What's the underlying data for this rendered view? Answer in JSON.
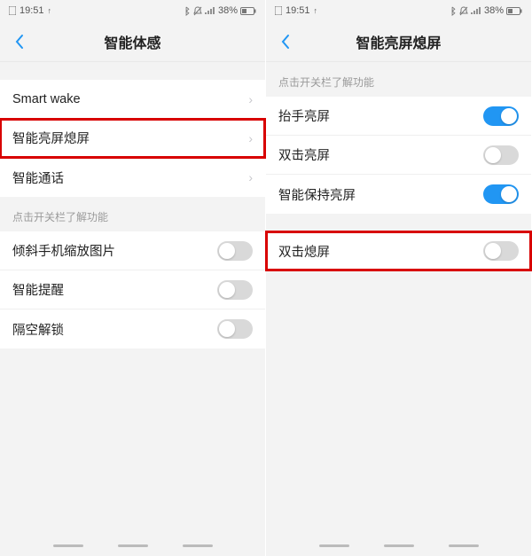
{
  "status": {
    "time": "19:51",
    "battery_pct": "38%",
    "up_arrow": "↑"
  },
  "left": {
    "title": "智能体感",
    "rows_nav": [
      {
        "label": "Smart wake"
      },
      {
        "label": "智能亮屏熄屏"
      },
      {
        "label": "智能通话"
      }
    ],
    "section_label": "点击开关栏了解功能",
    "rows_toggle": [
      {
        "label": "倾斜手机缩放图片",
        "on": false
      },
      {
        "label": "智能提醒",
        "on": false
      },
      {
        "label": "隔空解锁",
        "on": false
      }
    ]
  },
  "right": {
    "title": "智能亮屏熄屏",
    "section_label": "点击开关栏了解功能",
    "group1": [
      {
        "label": "抬手亮屏",
        "on": true
      },
      {
        "label": "双击亮屏",
        "on": false
      },
      {
        "label": "智能保持亮屏",
        "on": true
      }
    ],
    "group2": [
      {
        "label": "双击熄屏",
        "on": false
      }
    ]
  }
}
